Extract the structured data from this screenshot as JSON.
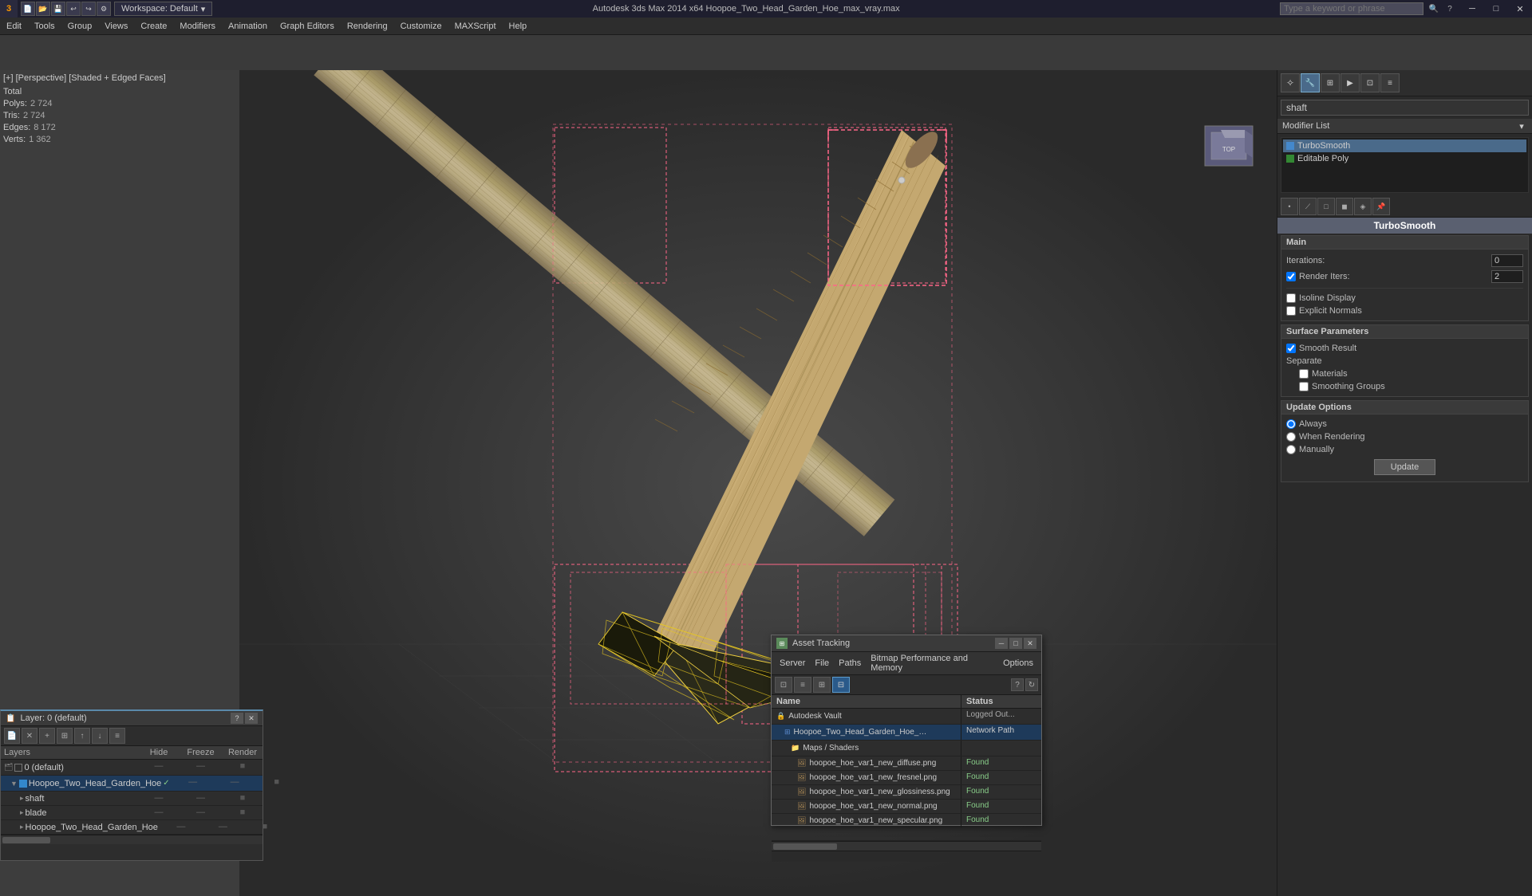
{
  "titlebar": {
    "app_title": "Autodesk 3ds Max 2014 x64",
    "file_title": "Hoopoe_Two_Head_Garden_Hoe_max_vray.max",
    "full_title": "Autodesk 3ds Max 2014 x64      Hoopoe_Two_Head_Garden_Hoe_max_vray.max",
    "workspace_label": "Workspace: Default",
    "search_placeholder": "Type a keyword or phrase",
    "win_min": "─",
    "win_max": "□",
    "win_close": "✕"
  },
  "menubar": {
    "items": [
      {
        "label": "Edit"
      },
      {
        "label": "Tools"
      },
      {
        "label": "Group"
      },
      {
        "label": "Views"
      },
      {
        "label": "Create"
      },
      {
        "label": "Modifiers"
      },
      {
        "label": "Animation"
      },
      {
        "label": "Graph Editors"
      },
      {
        "label": "Rendering"
      },
      {
        "label": "Customize"
      },
      {
        "label": "MAXScript"
      },
      {
        "label": "Help"
      }
    ]
  },
  "viewport": {
    "label": "[+] [Perspective] [Shaded + Edged Faces]"
  },
  "stats": {
    "polys_label": "Polys:",
    "polys_value": "2 724",
    "tris_label": "Tris:",
    "tris_value": "2 724",
    "edges_label": "Edges:",
    "edges_value": "8 172",
    "verts_label": "Verts:",
    "verts_value": "1 362",
    "total_label": "Total"
  },
  "command_panel": {
    "name_field": "shaft",
    "modifier_list_label": "Modifier List",
    "modifiers": [
      {
        "name": "TurboSmooth",
        "active": true
      },
      {
        "name": "Editable Poly",
        "active": false
      }
    ],
    "turbosmoothTitle": "TurboSmooth",
    "main_section": {
      "title": "Main",
      "iterations_label": "Iterations:",
      "iterations_value": "0",
      "render_iters_label": "Render Iters:",
      "render_iters_value": "2",
      "render_iters_checked": true,
      "isoline_display_label": "Isoline Display",
      "isoline_display_checked": false,
      "explicit_normals_label": "Explicit Normals",
      "explicit_normals_checked": false
    },
    "surface_section": {
      "title": "Surface Parameters",
      "smooth_result_label": "Smooth Result",
      "smooth_result_checked": true,
      "separate_label": "Separate",
      "materials_label": "Materials",
      "materials_checked": false,
      "smoothing_groups_label": "Smoothing Groups",
      "smoothing_groups_checked": false
    },
    "update_section": {
      "title": "Update Options",
      "always_label": "Always",
      "always_selected": true,
      "when_rendering_label": "When Rendering",
      "when_rendering_selected": false,
      "manually_label": "Manually",
      "manually_selected": false,
      "update_button": "Update"
    }
  },
  "layers_panel": {
    "title": "Layer: 0 (default)",
    "header": {
      "name": "Layers",
      "hide": "Hide",
      "freeze": "Freeze",
      "render": "Render"
    },
    "rows": [
      {
        "level": 0,
        "name": "0 (default)",
        "is_default": true,
        "hide": "—",
        "freeze": "—",
        "render": "■"
      },
      {
        "level": 1,
        "name": "Hoopoe_Two_Head_Garden_Hoe",
        "highlighted": true,
        "hide": "—",
        "freeze": "—",
        "render": "■"
      },
      {
        "level": 2,
        "name": "shaft",
        "hide": "—",
        "freeze": "—",
        "render": "■"
      },
      {
        "level": 2,
        "name": "blade",
        "hide": "—",
        "freeze": "—",
        "render": "■"
      },
      {
        "level": 2,
        "name": "Hoopoe_Two_Head_Garden_Hoe",
        "hide": "—",
        "freeze": "—",
        "render": "■"
      }
    ]
  },
  "asset_panel": {
    "title": "Asset Tracking",
    "menubar": [
      "Server",
      "File",
      "Paths",
      "Bitmap Performance and Memory",
      "Options"
    ],
    "toolbar_buttons": [
      "⊡",
      "≡",
      "⊞",
      "⊟"
    ],
    "active_toolbar_idx": 3,
    "table_header": {
      "name": "Name",
      "status": "Status"
    },
    "rows": [
      {
        "level": 0,
        "icon": "vault",
        "name": "Autodesk Vault",
        "status": "Logged Out..."
      },
      {
        "level": 1,
        "icon": "max",
        "name": "Hoopoe_Two_Head_Garden_Hoe_max_vray.max",
        "status": "Network Path",
        "highlighted": true
      },
      {
        "level": 2,
        "icon": "folder",
        "name": "Maps / Shaders",
        "status": ""
      },
      {
        "level": 3,
        "icon": "img",
        "name": "hoopoe_hoe_var1_new_diffuse.png",
        "status": "Found"
      },
      {
        "level": 3,
        "icon": "img",
        "name": "hoopoe_hoe_var1_new_fresnel.png",
        "status": "Found"
      },
      {
        "level": 3,
        "icon": "img",
        "name": "hoopoe_hoe_var1_new_glossiness.png",
        "status": "Found"
      },
      {
        "level": 3,
        "icon": "img",
        "name": "hoopoe_hoe_var1_new_normal.png",
        "status": "Found"
      },
      {
        "level": 3,
        "icon": "img",
        "name": "hoopoe_hoe_var1_new_specular.png",
        "status": "Found"
      }
    ]
  }
}
